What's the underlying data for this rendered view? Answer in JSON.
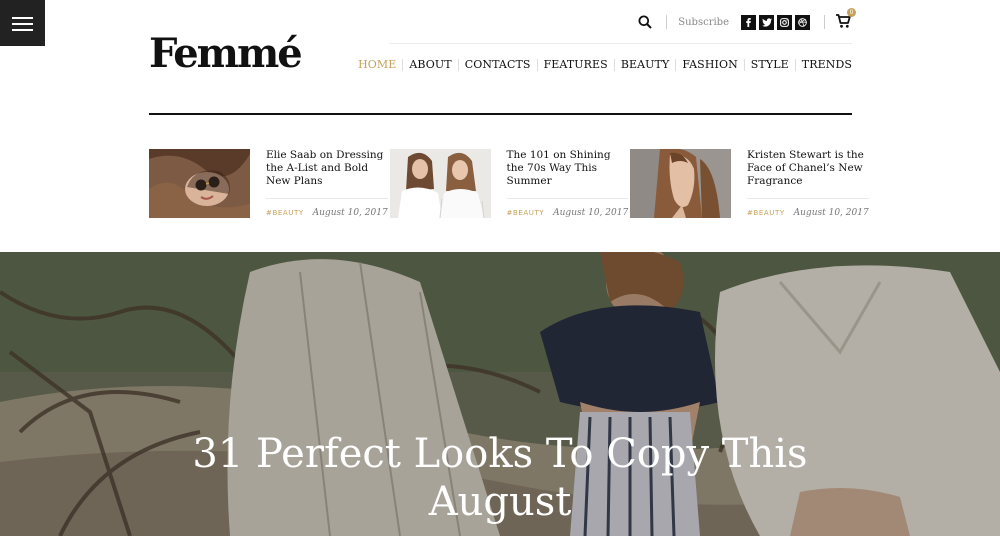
{
  "brand": {
    "logo": "Femmé"
  },
  "topbar": {
    "subscribe": "Subscribe",
    "social": [
      {
        "icon": "facebook-icon",
        "glyph": "f"
      },
      {
        "icon": "twitter-icon",
        "glyph": "t"
      },
      {
        "icon": "instagram-icon",
        "glyph": "◎"
      },
      {
        "icon": "dribbble-icon",
        "glyph": "⊛"
      }
    ],
    "cart_count": "0"
  },
  "nav": {
    "items": [
      {
        "label": "HOME",
        "active": true
      },
      {
        "label": "ABOUT",
        "active": false
      },
      {
        "label": "CONTACTS",
        "active": false
      },
      {
        "label": "FEATURES",
        "active": false
      },
      {
        "label": "BEAUTY",
        "active": false
      },
      {
        "label": "FASHION",
        "active": false
      },
      {
        "label": "STYLE",
        "active": false
      },
      {
        "label": "TRENDS",
        "active": false
      }
    ]
  },
  "featured_posts": [
    {
      "title": "Elie Saab on Dressing the A-List and Bold New Plans",
      "tag": "#BEAUTY",
      "date": "August 10, 2017"
    },
    {
      "title": "The 101 on Shining the 70s Way This Summer",
      "tag": "#BEAUTY",
      "date": "August 10, 2017"
    },
    {
      "title": "Kristen Stewart is the Face of Chanel’s New Fragrance",
      "tag": "#BEAUTY",
      "date": "August 10, 2017"
    }
  ],
  "hero": {
    "title": "31 Perfect Looks To Copy This August"
  },
  "colors": {
    "accent": "#c5a15a",
    "dark": "#111111",
    "menu_bg": "#222222"
  }
}
